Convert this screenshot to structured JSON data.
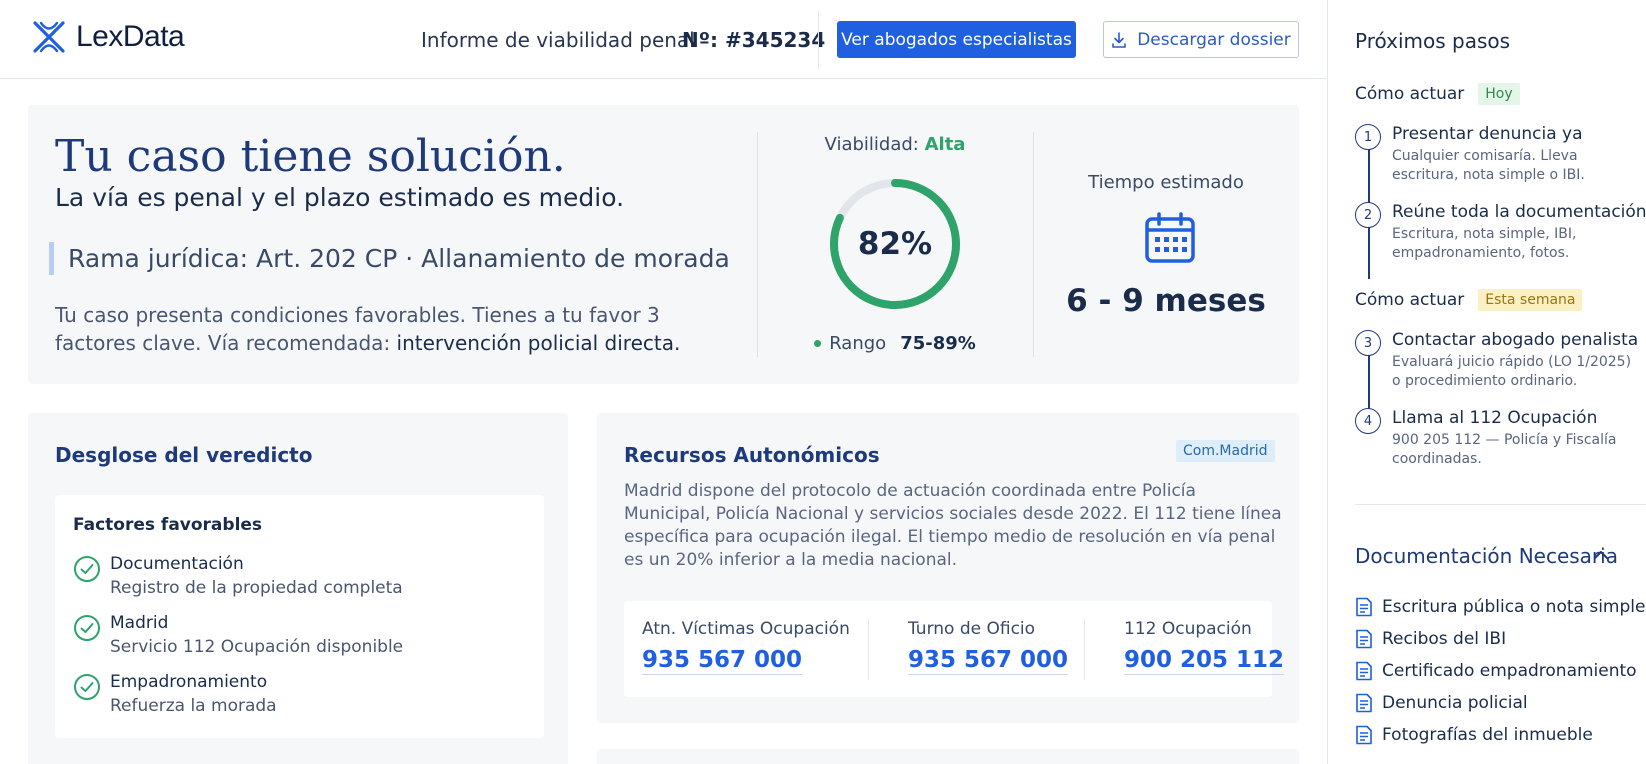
{
  "brand": {
    "name": "LexData",
    "logo_icon": "x-logo-icon"
  },
  "header": {
    "report_title": "Informe de viabilidad penal",
    "report_number": "Nº: #345234",
    "primary_button": "Ver abogados especialistas",
    "secondary_button": "Descargar dossier",
    "secondary_icon": "download-icon",
    "accent_color": "#1f5fe0"
  },
  "hero": {
    "title": "Tu caso tiene solución.",
    "subtitle": "La vía es penal y el plazo estimado es medio.",
    "legal_branch": "Rama jurídica: Art. 202 CP · Allanamiento de morada",
    "description": "Tu caso presenta condiciones favorables. Tienes a tu favor 3 factores clave. Vía recomendada:",
    "recommended_path": "intervención policial directa.",
    "viability": {
      "label": "Viabilidad:",
      "level": "Alta",
      "percent_text": "82%",
      "percent": 82,
      "range_label": "Rango",
      "range_value": "75-89%",
      "color": "#2ea36a"
    },
    "time": {
      "label": "Tiempo estimado",
      "value": "6 - 9 meses",
      "icon": "calendar-icon"
    }
  },
  "verdict": {
    "title": "Desglose del veredicto",
    "favorable_title": "Factores favorables",
    "factors": [
      {
        "title": "Documentación",
        "detail": "Registro de la propiedad completa",
        "icon": "check-circle-icon"
      },
      {
        "title": "Madrid",
        "detail": "Servicio 112 Ocupación disponible",
        "icon": "check-circle-icon"
      },
      {
        "title": "Empadronamiento",
        "detail": "Refuerza la morada",
        "icon": "check-circle-icon"
      }
    ]
  },
  "resources": {
    "title": "Recursos Autonómicos",
    "badge": "Com.Madrid",
    "description": "Madrid dispone del protocolo de actuación coordinada entre Policía Municipal, Policía Nacional y servicios sociales desde 2022. El 112 tiene línea específica para ocupación ilegal. El tiempo medio de resolución en vía penal es un 20% inferior a la media nacional.",
    "contacts": [
      {
        "label": "Atn. Víctimas Ocupación",
        "number": "935 567 000"
      },
      {
        "label": "Turno de Oficio",
        "number": "935 567 000"
      },
      {
        "label": "112 Ocupación",
        "number": "900 205 112"
      }
    ]
  },
  "sidebar": {
    "title": "Próximos pasos",
    "groups": [
      {
        "label": "Cómo actuar",
        "badge": "Hoy",
        "steps": [
          {
            "num": "1",
            "title": "Presentar denuncia ya",
            "detail": "Cualquier comisaría. Lleva escritura, nota simple o IBI."
          },
          {
            "num": "2",
            "title": "Reúne toda la documentación",
            "detail": "Escritura, nota simple, IBI, empadronamiento, fotos."
          }
        ]
      },
      {
        "label": "Cómo actuar",
        "badge": "Esta semana",
        "steps": [
          {
            "num": "3",
            "title": "Contactar abogado penalista",
            "detail": "Evaluará juicio rápido (LO 1/2025) o procedimiento ordinario."
          },
          {
            "num": "4",
            "title": "Llama al 112 Ocupación",
            "detail": "900 205 112 — Policía y Fiscalía coordinadas."
          }
        ]
      }
    ],
    "docs_title": "Documentación Necesaria",
    "docs_toggle_icon": "chevron-up-icon",
    "docs": [
      "Escritura pública o nota simple",
      "Recibos del IBI",
      "Certificado empadronamiento",
      "Denuncia policial",
      "Fotografías del inmueble"
    ]
  }
}
